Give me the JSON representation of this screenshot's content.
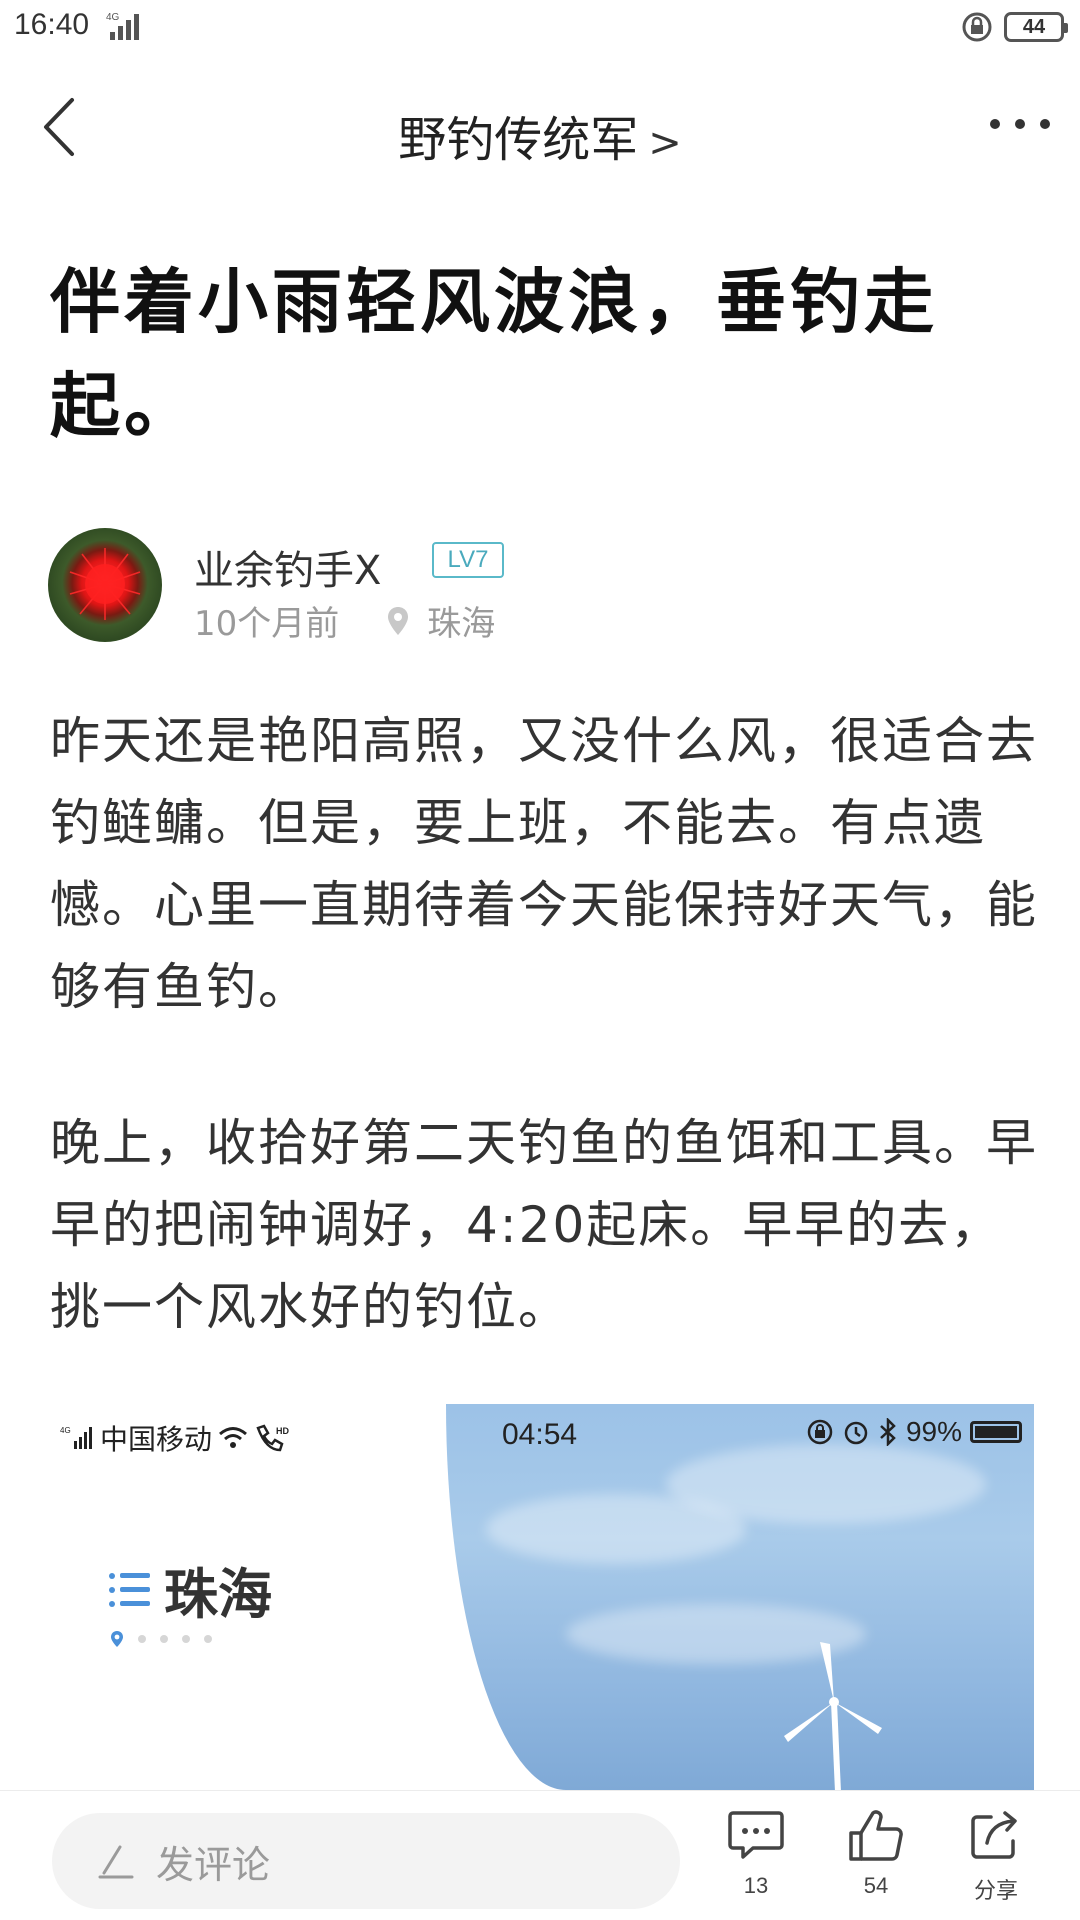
{
  "status_bar": {
    "time": "16:40",
    "network": "4G",
    "battery": "44"
  },
  "nav": {
    "title": "野钓传统军",
    "title_chevron": ">"
  },
  "post": {
    "title": "伴着小雨轻风波浪，垂钓走起。",
    "author": {
      "name": "业余钓手X",
      "level": "LV7",
      "time_ago": "10个月前",
      "location": "珠海"
    },
    "paragraphs": [
      "昨天还是艳阳高照，又没什么风，很适合去钓鲢鳙。但是，要上班，不能去。有点遗憾。心里一直期待着今天能保持好天气，能够有鱼钓。",
      "晚上，收拾好第二天钓鱼的鱼饵和工具。早早的把闹钟调好，4:20起床。早早的去，挑一个风水好的钓位。"
    ]
  },
  "embedded_screenshot": {
    "carrier": "中国移动",
    "time": "04:54",
    "battery": "99%",
    "city": "珠海",
    "hd": "HD",
    "signal": "4G"
  },
  "bottom_bar": {
    "comment_placeholder": "发评论",
    "comment_count": "13",
    "like_count": "54",
    "share_label": "分享"
  }
}
